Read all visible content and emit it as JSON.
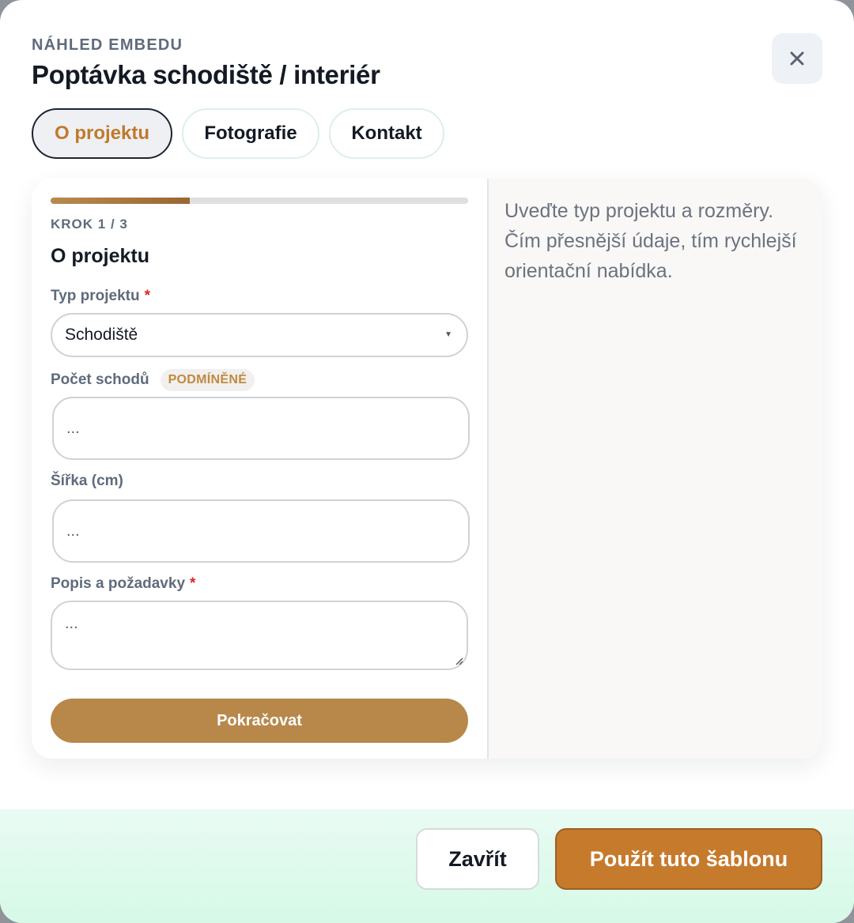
{
  "header": {
    "eyebrow": "NÁHLED EMBEDU",
    "title": "Poptávka schodiště / interiér",
    "close_icon": "close-icon"
  },
  "tabs": [
    {
      "label": "O projektu",
      "active": true
    },
    {
      "label": "Fotografie",
      "active": false
    },
    {
      "label": "Kontakt",
      "active": false
    }
  ],
  "form": {
    "progress_fraction": 0.333,
    "step": "KROK 1 / 3",
    "section_title": "O projektu",
    "project_type": {
      "label": "Typ projektu",
      "required_mark": "*",
      "value": "Schodiště",
      "caret": "▼"
    },
    "step_count": {
      "label": "Počet schodů",
      "badge": "PODMÍNĚNÉ",
      "placeholder": "..."
    },
    "width": {
      "label": "Šířka (cm)",
      "placeholder": "..."
    },
    "description": {
      "label": "Popis a požadavky",
      "required_mark": "*",
      "placeholder": "..."
    },
    "continue_label": "Pokračovat"
  },
  "hint": "Uveďte typ projektu a rozměry. Čím přesnější údaje, tím rychlejší orientační nabídka.",
  "footer": {
    "close_label": "Zavřít",
    "use_label": "Použít tuto šablonu"
  },
  "colors": {
    "accent": "#c67a2c",
    "primary_button": "#b8884b",
    "required": "#dc2626",
    "footer_bg": "#d6f9e7"
  }
}
